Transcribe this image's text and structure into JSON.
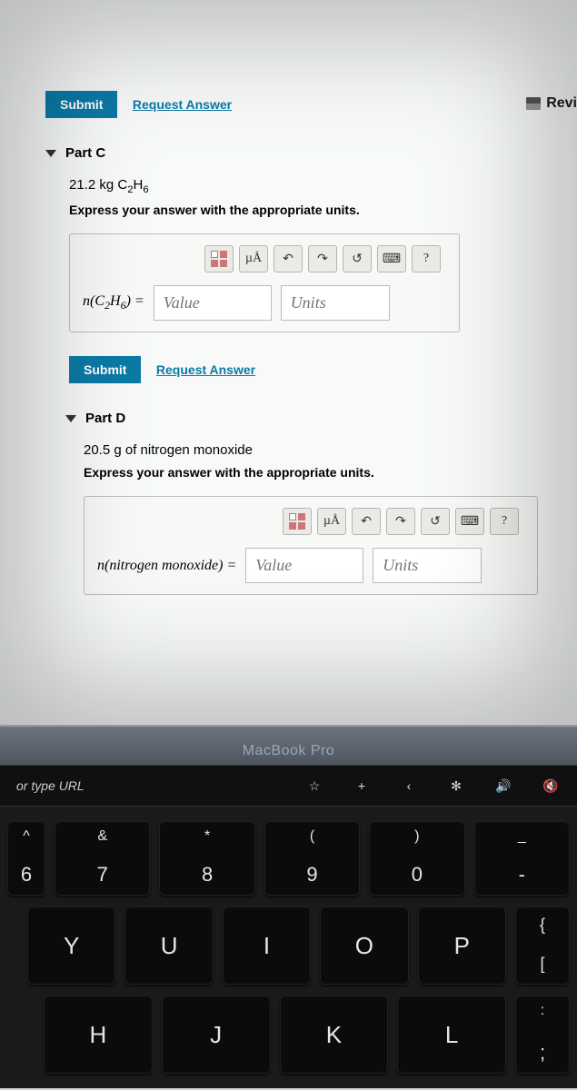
{
  "top_right": {
    "label": "Revi"
  },
  "submit_label": "Submit",
  "request_label": "Request Answer",
  "partC": {
    "title": "Part C",
    "given_prefix": "21.2 kg C",
    "given_sub1": "2",
    "given_mid": "H",
    "given_sub2": "6",
    "instruction": "Express your answer with the appropriate units.",
    "lhs_prefix": "n(C",
    "lhs_sub1": "2",
    "lhs_mid": "H",
    "lhs_sub2": "6",
    "lhs_suffix": ") =",
    "value_placeholder": "Value",
    "units_placeholder": "Units"
  },
  "partD": {
    "title": "Part D",
    "given": "20.5 g of nitrogen monoxide",
    "instruction": "Express your answer with the appropriate units.",
    "lhs": "n(nitrogen monoxide) =",
    "value_placeholder": "Value",
    "units_placeholder": "Units"
  },
  "toolbar": {
    "mu": "µÅ",
    "undo": "↶",
    "redo": "↷",
    "reset": "↺",
    "kbd": "⌨",
    "help": "?"
  },
  "device": {
    "bezel": "MacBook Pro",
    "touchbar": {
      "url_hint": "or type URL",
      "star": "☆",
      "plus": "+",
      "back": "‹",
      "bright": "✻",
      "vol": "🔊",
      "mute": "🔇"
    },
    "keys": {
      "r1": [
        {
          "u": "^",
          "m": "6"
        },
        {
          "u": "&",
          "m": "7"
        },
        {
          "u": "*",
          "m": "8"
        },
        {
          "u": "(",
          "m": "9"
        },
        {
          "u": ")",
          "m": "0"
        },
        {
          "u": "_",
          "m": "-"
        }
      ],
      "r2": [
        "Y",
        "U",
        "I",
        "O",
        "P"
      ],
      "r2_bracket": {
        "u": "{",
        "m": "["
      },
      "r3": [
        "H",
        "J",
        "K",
        "L"
      ],
      "r3_semi": {
        "u": ":",
        "m": ";"
      }
    }
  }
}
